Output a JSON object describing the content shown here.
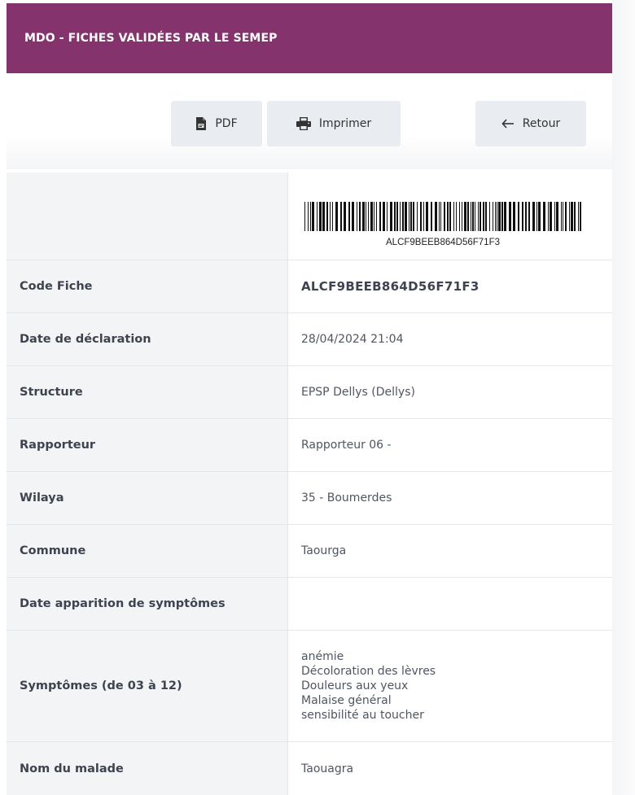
{
  "header": {
    "title": "MDO - FICHES VALIDÉES PAR LE SEMEP"
  },
  "toolbar": {
    "pdf_label": "PDF",
    "print_label": "Imprimer",
    "back_label": "Retour",
    "pdf_icon": "file-pdf-icon",
    "print_icon": "printer-icon",
    "back_icon": "arrow-left-icon"
  },
  "barcode": {
    "text": "ALCF9BEEB864D56F71F3"
  },
  "fields": [
    {
      "label": "Code Fiche",
      "value": "ALCF9BEEB864D56F71F3"
    },
    {
      "label": "Date de déclaration",
      "value": "28/04/2024 21:04"
    },
    {
      "label": "Structure",
      "value": "EPSP Dellys (Dellys)"
    },
    {
      "label": "Rapporteur",
      "value": "Rapporteur 06 -"
    },
    {
      "label": "Wilaya",
      "value": "35 - Boumerdes"
    },
    {
      "label": "Commune",
      "value": "Taourga"
    },
    {
      "label": "Date apparition de symptômes",
      "value": ""
    },
    {
      "label": "Symptômes (de 03 à 12)",
      "values": [
        "anémie",
        "Décoloration des lèvres",
        "Douleurs aux yeux",
        "Malaise général",
        "sensibilité au toucher"
      ]
    },
    {
      "label": "Nom du malade",
      "value": "Taouagra"
    }
  ],
  "colors": {
    "header_bg": "#85336d",
    "button_bg": "#e9edf1",
    "label_bg": "#f3f4f6"
  }
}
